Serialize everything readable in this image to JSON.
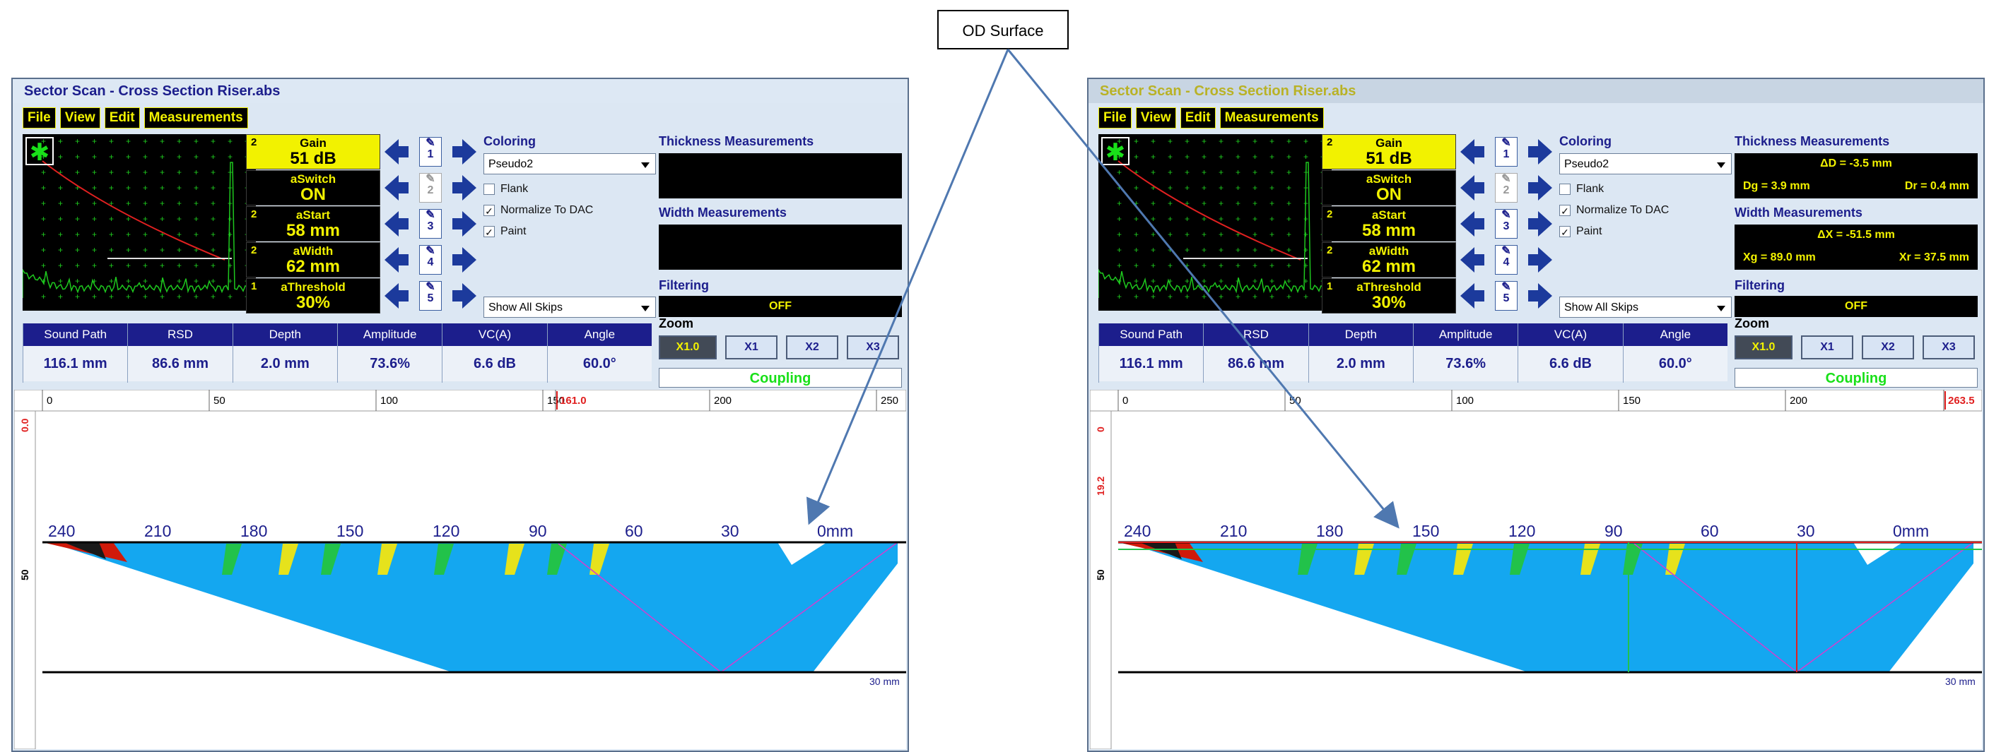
{
  "callout": {
    "label": "OD Surface"
  },
  "colors": {
    "arrow": "#4f78b0",
    "accent": "#1c1e8c",
    "highlight": "#f2f200",
    "scan": "#14a7f0"
  },
  "panels": [
    {
      "title": "Sector Scan - Cross Section Riser.abs",
      "menu": [
        "File",
        "View",
        "Edit",
        "Measurements"
      ],
      "params": [
        {
          "num": "2",
          "label": "Gain",
          "value": "51 dB"
        },
        {
          "num": "",
          "label": "aSwitch",
          "value": "ON"
        },
        {
          "num": "2",
          "label": "aStart",
          "value": "58 mm"
        },
        {
          "num": "2",
          "label": "aWidth",
          "value": "62 mm"
        },
        {
          "num": "1",
          "label": "aThreshold",
          "value": "30%"
        }
      ],
      "pencils": [
        "1",
        "2",
        "3",
        "4",
        "5"
      ],
      "coloring": {
        "label": "Coloring",
        "selected": "Pseudo2",
        "flank": "Flank",
        "normalize": "Normalize To DAC",
        "paint": "Paint",
        "skips": "Show All Skips"
      },
      "thickness": {
        "label": "Thickness Measurements",
        "center": "",
        "left": "",
        "right": ""
      },
      "width": {
        "label": "Width Measurements",
        "center": "",
        "left": "",
        "right": ""
      },
      "filtering": {
        "label": "Filtering",
        "value": "OFF"
      },
      "readout_headers": [
        "Sound Path",
        "RSD",
        "Depth",
        "Amplitude",
        "VC(A)",
        "Angle"
      ],
      "readout_values": [
        "116.1 mm",
        "86.6 mm",
        "2.0 mm",
        "73.6%",
        "6.6 dB",
        "60.0°"
      ],
      "zoom": {
        "label": "Zoom",
        "buttons": [
          "X1.0",
          "X1",
          "X2",
          "X3"
        ]
      },
      "coupling": "Coupling",
      "ruler_top": [
        "0",
        "50",
        "100",
        "150",
        "161.0",
        "200",
        "250"
      ],
      "ruler_left": [
        "0.0",
        "50"
      ],
      "angles": [
        "240",
        "210",
        "180",
        "150",
        "120",
        "90",
        "60",
        "30",
        "0mm"
      ],
      "depth_label": "30 mm"
    },
    {
      "title": "Sector Scan - Cross Section Riser.abs",
      "menu": [
        "File",
        "View",
        "Edit",
        "Measurements"
      ],
      "params": [
        {
          "num": "2",
          "label": "Gain",
          "value": "51 dB"
        },
        {
          "num": "",
          "label": "aSwitch",
          "value": "ON"
        },
        {
          "num": "2",
          "label": "aStart",
          "value": "58 mm"
        },
        {
          "num": "2",
          "label": "aWidth",
          "value": "62 mm"
        },
        {
          "num": "1",
          "label": "aThreshold",
          "value": "30%"
        }
      ],
      "pencils": [
        "1",
        "2",
        "3",
        "4",
        "5"
      ],
      "coloring": {
        "label": "Coloring",
        "selected": "Pseudo2",
        "flank": "Flank",
        "normalize": "Normalize To DAC",
        "paint": "Paint",
        "skips": "Show All Skips"
      },
      "thickness": {
        "label": "Thickness Measurements",
        "center": "ΔD = -3.5 mm",
        "left": "Dg = 3.9 mm",
        "right": "Dr = 0.4 mm"
      },
      "width": {
        "label": "Width Measurements",
        "center": "ΔX = -51.5 mm",
        "left": "Xg = 89.0 mm",
        "right": "Xr = 37.5 mm"
      },
      "filtering": {
        "label": "Filtering",
        "value": "OFF"
      },
      "readout_headers": [
        "Sound Path",
        "RSD",
        "Depth",
        "Amplitude",
        "VC(A)",
        "Angle"
      ],
      "readout_values": [
        "116.1 mm",
        "86.6 mm",
        "2.0 mm",
        "73.6%",
        "6.6 dB",
        "60.0°"
      ],
      "zoom": {
        "label": "Zoom",
        "buttons": [
          "X1.0",
          "X1",
          "X2",
          "X3"
        ]
      },
      "coupling": "Coupling",
      "ruler_top": [
        "0",
        "50",
        "100",
        "150",
        "200",
        "263.5"
      ],
      "ruler_left": [
        "0",
        "19.2",
        "50"
      ],
      "angles": [
        "240",
        "210",
        "180",
        "150",
        "120",
        "90",
        "60",
        "30",
        "0mm"
      ],
      "depth_label": "30 mm"
    }
  ]
}
